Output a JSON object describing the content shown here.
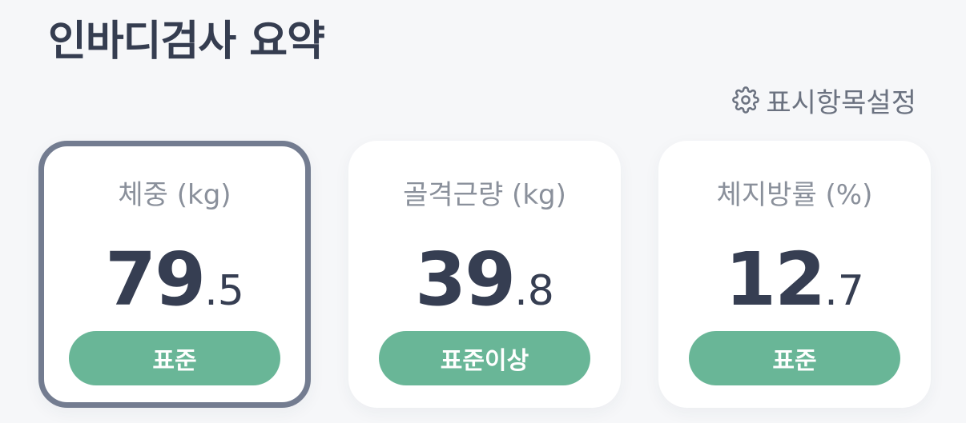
{
  "header": {
    "title": "인바디검사 요약"
  },
  "settings": {
    "label": "표시항목설정",
    "icon": "gear-icon"
  },
  "cards": [
    {
      "label": "체중 (kg)",
      "value_int": "79",
      "value_dec": ".5",
      "status": "표준",
      "selected": true
    },
    {
      "label": "골격근량 (kg)",
      "value_int": "39",
      "value_dec": ".8",
      "status": "표준이상",
      "selected": false
    },
    {
      "label": "체지방률 (%)",
      "value_int": "12",
      "value_dec": ".7",
      "status": "표준",
      "selected": false
    }
  ],
  "colors": {
    "background": "#f6f7f9",
    "card": "#ffffff",
    "selected_border": "#737c90",
    "status_green": "#69b697",
    "value_text": "#363e52",
    "label_text": "#8a909b"
  }
}
